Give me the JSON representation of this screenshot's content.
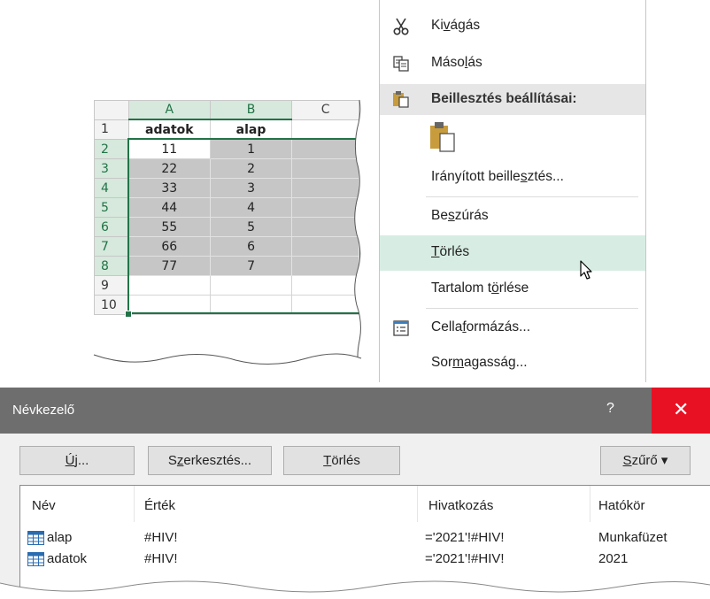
{
  "spreadsheet": {
    "columns": [
      "A",
      "B",
      "C"
    ],
    "row_numbers": [
      "1",
      "2",
      "3",
      "4",
      "5",
      "6",
      "7",
      "8",
      "9",
      "10"
    ],
    "header_row": {
      "a": "adatok",
      "b": "alap"
    },
    "rows": [
      {
        "a": "11",
        "b": "1"
      },
      {
        "a": "22",
        "b": "2"
      },
      {
        "a": "33",
        "b": "3"
      },
      {
        "a": "44",
        "b": "4"
      },
      {
        "a": "55",
        "b": "5"
      },
      {
        "a": "66",
        "b": "6"
      },
      {
        "a": "77",
        "b": "7"
      }
    ],
    "accent_color": "#217346",
    "selection_fill": "#c6c6c6"
  },
  "context_menu": {
    "cut": {
      "pre": "Ki",
      "u": "v",
      "post": "ágás",
      "icon": "scissors-icon"
    },
    "copy": {
      "pre": "Máso",
      "u": "l",
      "post": "ás",
      "icon": "copy-icon"
    },
    "paste_options_header": "Beillesztés beállításai:",
    "paste_special": {
      "pre": "Irányított beille",
      "u": "s",
      "post": "ztés..."
    },
    "insert": {
      "pre": "Be",
      "u": "s",
      "post": "zúrás"
    },
    "delete": {
      "pre": "",
      "u": "T",
      "post": "örlés"
    },
    "clear_contents": {
      "pre": "Tartalom t",
      "u": "ö",
      "post": "rlése"
    },
    "format_cells": {
      "pre": "Cella",
      "u": "f",
      "post": "ormázás..."
    },
    "row_height": {
      "pre": "Sor",
      "u": "m",
      "post": "agasság..."
    },
    "hover_color": "#d7ede3"
  },
  "name_manager": {
    "title": "Névkezelő",
    "help": "?",
    "close": "✕",
    "buttons": {
      "new": {
        "pre": "",
        "u": "Ú",
        "post": "j..."
      },
      "edit": {
        "pre": "S",
        "u": "z",
        "post": "erkesztés..."
      },
      "delete": {
        "pre": "",
        "u": "T",
        "post": "örlés"
      },
      "filter": {
        "pre": "",
        "u": "S",
        "post": "zűrő ▾"
      }
    },
    "columns": [
      "Név",
      "Érték",
      "Hivatkozás",
      "Hatókör"
    ],
    "rows": [
      {
        "name": "alap",
        "value": "#HIV!",
        "refers_to": "='2021'!#HIV!",
        "scope": "Munkafüzet"
      },
      {
        "name": "adatok",
        "value": "#HIV!",
        "refers_to": "='2021'!#HIV!",
        "scope": "2021"
      }
    ]
  }
}
